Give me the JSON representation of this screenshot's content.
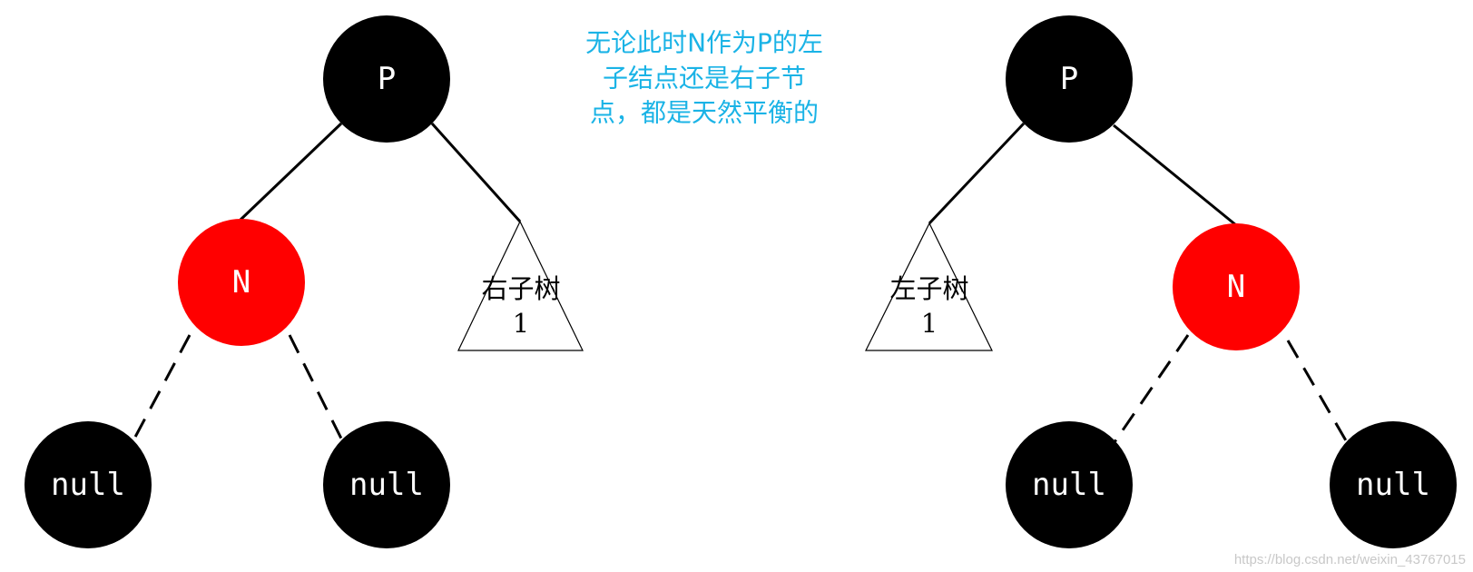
{
  "note": {
    "lines": [
      "无论此时N作为P的左",
      "子结点还是右子节",
      "点，都是天然平衡的"
    ],
    "color": "#1ab3e6"
  },
  "colors": {
    "black_node": "#000000",
    "red_node": "#ff0000",
    "node_text": "#ffffff"
  },
  "trees": [
    {
      "id": "left-case",
      "parent": {
        "label": "P",
        "color": "black"
      },
      "child_n": {
        "label": "N",
        "color": "red",
        "side": "left"
      },
      "subtree": {
        "line1": "右子树",
        "line2": "1",
        "side": "right"
      },
      "null_children": [
        {
          "label": "null",
          "color": "black"
        },
        {
          "label": "null",
          "color": "black"
        }
      ]
    },
    {
      "id": "right-case",
      "parent": {
        "label": "P",
        "color": "black"
      },
      "child_n": {
        "label": "N",
        "color": "red",
        "side": "right"
      },
      "subtree": {
        "line1": "左子树",
        "line2": "1",
        "side": "left"
      },
      "null_children": [
        {
          "label": "null",
          "color": "black"
        },
        {
          "label": "null",
          "color": "black"
        }
      ]
    }
  ],
  "watermark": "https://blog.csdn.net/weixin_43767015"
}
